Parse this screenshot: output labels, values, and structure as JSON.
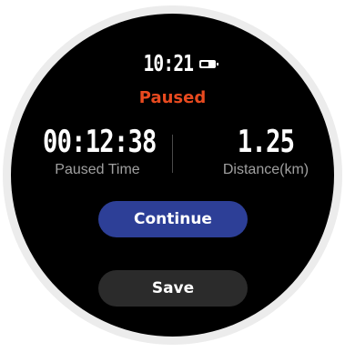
{
  "status_bar": {
    "time": "10:21",
    "battery_icon": "battery-icon"
  },
  "workout": {
    "state": "Paused",
    "metrics": [
      {
        "value": "00:12:38",
        "label": "Paused Time"
      },
      {
        "value": "1.25",
        "label": "Distance(km)"
      }
    ]
  },
  "actions": {
    "continue_label": "Continue",
    "save_label": "Save"
  },
  "colors": {
    "accent": "#e84a1f",
    "continue_button": "#2d3f97",
    "save_button": "#2b2b2b",
    "ring": "#e12a06"
  }
}
